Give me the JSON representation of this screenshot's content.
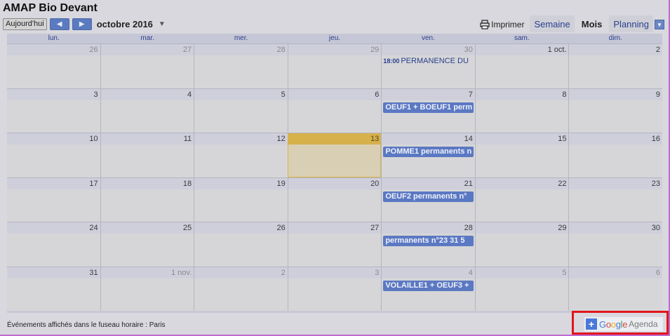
{
  "app": {
    "title": "AMAP Bio Devant"
  },
  "toolbar": {
    "today_label": "Aujourd'hui",
    "prev_icon": "arrow-left-icon",
    "next_icon": "arrow-right-icon",
    "month_label": "octobre 2016",
    "month_dropdown_icon": "chevron-down-icon",
    "print_label": "Imprimer",
    "print_icon": "printer-icon"
  },
  "views": [
    {
      "label": "Semaine",
      "active": false
    },
    {
      "label": "Mois",
      "active": true
    },
    {
      "label": "Planning",
      "active": false
    }
  ],
  "view_dropdown_icon": "chevron-down-icon",
  "weekdays": [
    "lun.",
    "mar.",
    "mer.",
    "jeu.",
    "ven.",
    "sam.",
    "dim."
  ],
  "weeks": [
    {
      "days": [
        {
          "label": "26",
          "other": true
        },
        {
          "label": "27",
          "other": true
        },
        {
          "label": "28",
          "other": true
        },
        {
          "label": "29",
          "other": true
        },
        {
          "label": "30",
          "other": true,
          "event_time": "18:00",
          "event_text": "PERMANENCE DU"
        },
        {
          "label": "1 oct."
        },
        {
          "label": "2"
        }
      ]
    },
    {
      "days": [
        {
          "label": "3"
        },
        {
          "label": "4"
        },
        {
          "label": "5"
        },
        {
          "label": "6"
        },
        {
          "label": "7",
          "chip": "OEUF1 + BOEUF1 perm"
        },
        {
          "label": "8"
        },
        {
          "label": "9"
        }
      ]
    },
    {
      "days": [
        {
          "label": "10"
        },
        {
          "label": "11"
        },
        {
          "label": "12"
        },
        {
          "label": "13",
          "today": true
        },
        {
          "label": "14",
          "chip": "POMME1 permanents n"
        },
        {
          "label": "15"
        },
        {
          "label": "16"
        }
      ]
    },
    {
      "days": [
        {
          "label": "17"
        },
        {
          "label": "18"
        },
        {
          "label": "19"
        },
        {
          "label": "20"
        },
        {
          "label": "21",
          "chip": "OEUF2 permanents n°"
        },
        {
          "label": "22"
        },
        {
          "label": "23"
        }
      ]
    },
    {
      "days": [
        {
          "label": "24"
        },
        {
          "label": "25"
        },
        {
          "label": "26"
        },
        {
          "label": "27"
        },
        {
          "label": "28",
          "chip": "permanents n°23 31 5"
        },
        {
          "label": "29"
        },
        {
          "label": "30"
        }
      ]
    },
    {
      "days": [
        {
          "label": "31"
        },
        {
          "label": "1 nov.",
          "other": true
        },
        {
          "label": "2",
          "other": true
        },
        {
          "label": "3",
          "other": true
        },
        {
          "label": "4",
          "other": true,
          "chip": "VOLAILLE1 + OEUF3 +"
        },
        {
          "label": "5",
          "other": true
        },
        {
          "label": "6",
          "other": true
        }
      ]
    }
  ],
  "footer": {
    "timezone_note": "Événements affichés dans le fuseau horaire : Paris"
  },
  "badge": {
    "plus_icon": "plus-icon",
    "brand_letters": [
      "G",
      "o",
      "o",
      "g",
      "l",
      "e"
    ],
    "product": "Agenda"
  },
  "colors": {
    "event_chip": "#5b78c2",
    "today_header": "#d6b04a",
    "highlight_box": "#e0161c",
    "accent_blue": "#4a78d8"
  }
}
